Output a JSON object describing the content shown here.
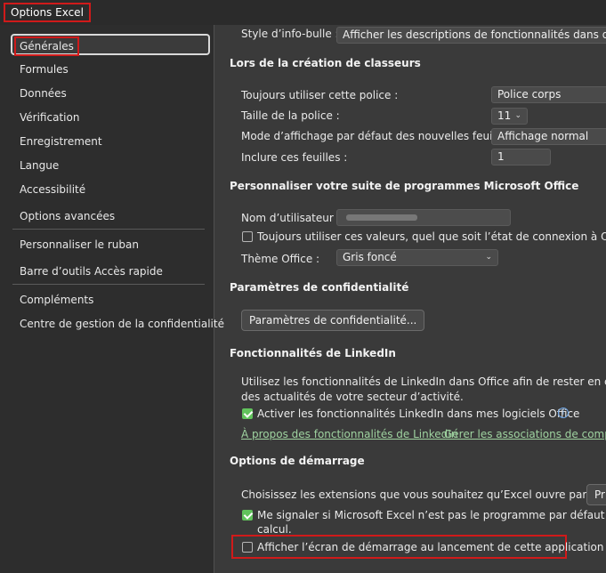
{
  "window": {
    "title": "Options Excel"
  },
  "sidebar": {
    "items": [
      {
        "label": "Générales"
      },
      {
        "label": "Formules"
      },
      {
        "label": "Données"
      },
      {
        "label": "Vérification"
      },
      {
        "label": "Enregistrement"
      },
      {
        "label": "Langue"
      },
      {
        "label": "Accessibilité"
      },
      {
        "label": "Options avancées"
      },
      {
        "label": "Personnaliser le ruban"
      },
      {
        "label": "Barre d’outils Accès rapide"
      },
      {
        "label": "Compléments"
      },
      {
        "label": "Centre de gestion de la confidentialité"
      }
    ]
  },
  "main": {
    "tooltip": {
      "label": "Style d’info-bulle :",
      "value": "Afficher les descriptions de fonctionnalités dans des info"
    },
    "creation": {
      "title": "Lors de la création de classeurs",
      "font_label": "Toujours utiliser cette police :",
      "font_value": "Police corps",
      "size_label": "Taille de la police :",
      "size_value": "11",
      "view_label": "Mode d’affichage par défaut des nouvelles feuilles :",
      "view_value": "Affichage normal",
      "sheets_label": "Inclure ces feuilles :",
      "sheets_value": "1"
    },
    "personalize": {
      "title": "Personnaliser votre suite de programmes Microsoft Office",
      "username_label": "Nom d’utilisateur :",
      "username_value": "",
      "always_label": "Toujours utiliser ces valeurs, quel que soit l’état de connexion à Office",
      "theme_label": "Thème Office :",
      "theme_value": "Gris foncé"
    },
    "privacy": {
      "title": "Paramètres de confidentialité",
      "button": "Paramètres de confidentialité..."
    },
    "linkedin": {
      "title": "Fonctionnalités de LinkedIn",
      "desc_line1": "Utilisez les fonctionnalités de LinkedIn dans Office afin de rester en contact ave",
      "desc_line2": "des actualités de votre secteur d’activité.",
      "enable_label": "Activer les fonctionnalités LinkedIn dans mes logiciels Office",
      "link_about": "À propos des fonctionnalités de LinkedIn",
      "link_manage": "Gérer les associations de compte L"
    },
    "startup": {
      "title": "Options de démarrage",
      "ext_label": "Choisissez les extensions que vous souhaitez qu’Excel ouvre par défaut :",
      "ext_button": "Pr",
      "default_line1": "Me signaler si Microsoft Excel n’est pas le programme par défaut pour l’aff",
      "default_line2": "calcul.",
      "splash_label": "Afficher l’écran de démarrage au lancement de cette application"
    }
  }
}
